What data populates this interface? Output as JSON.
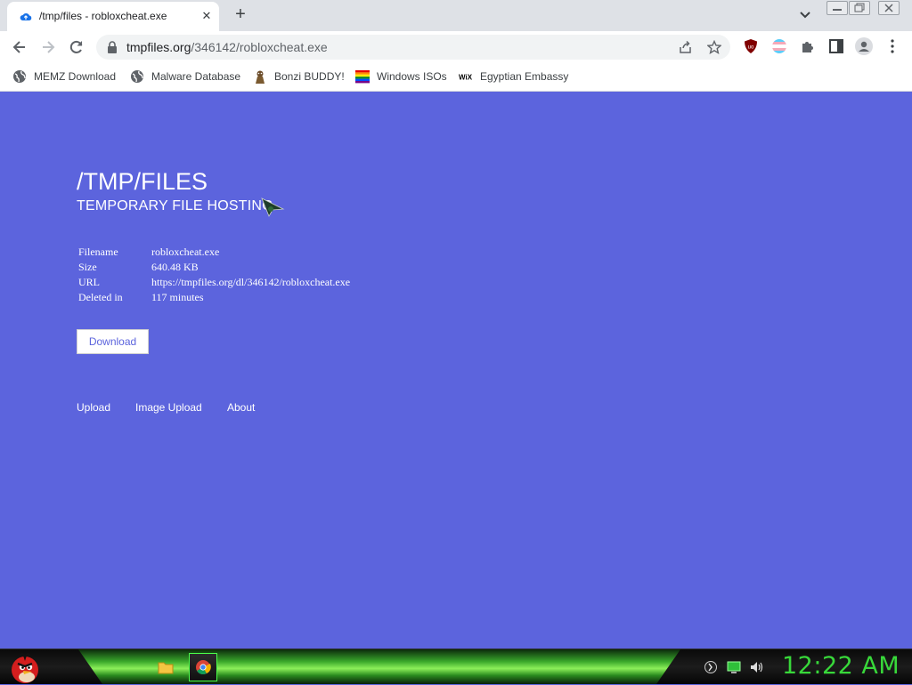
{
  "browser": {
    "tab": {
      "title": "/tmp/files - robloxcheat.exe"
    },
    "address": {
      "host": "tmpfiles.org",
      "path": "/346142/robloxcheat.exe"
    }
  },
  "bookmarks": [
    {
      "label": "MEMZ Download",
      "icon": "globe-icon"
    },
    {
      "label": "Malware Database",
      "icon": "globe-icon"
    },
    {
      "label": "Bonzi BUDDY!",
      "icon": "bonzi-icon"
    },
    {
      "label": "Windows ISOs",
      "icon": "rainbow-flag-icon"
    },
    {
      "label": "Egyptian Embassy",
      "icon": "wix-icon"
    }
  ],
  "page": {
    "title": "/TMP/FILES",
    "subtitle": "TEMPORARY FILE HOSTING",
    "file_info": [
      {
        "label": "Filename",
        "value": "robloxcheat.exe"
      },
      {
        "label": "Size",
        "value": "640.48 KB"
      },
      {
        "label": "URL",
        "value": "https://tmpfiles.org/dl/346142/robloxcheat.exe"
      },
      {
        "label": "Deleted in",
        "value": "117 minutes"
      }
    ],
    "download_label": "Download",
    "footer_links": [
      "Upload",
      "Image Upload",
      "About"
    ]
  },
  "taskbar": {
    "clock": "12:22 AM"
  },
  "colors": {
    "page_bg": "#5c64dd",
    "clock": "#38d83a"
  }
}
